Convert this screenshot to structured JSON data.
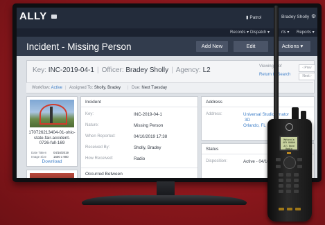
{
  "app": {
    "logo": "ALLY",
    "mail_icon": "mail-icon",
    "mode_label": "Patrol",
    "user_name": "Bradey Sholly",
    "settings_icon": "gear-icon"
  },
  "nav": {
    "items": [
      "Records",
      "Dispatch",
      "rts",
      "Reports"
    ]
  },
  "title_bar": {
    "title": "Incident - Missing Person",
    "buttons": {
      "add_new": "Add New",
      "edit": "Edit",
      "actions": "Actions"
    }
  },
  "summary": {
    "key_label": "Key:",
    "key_value": "INC-2019-04-1",
    "officer_label": "Officer:",
    "officer_value": "Bradey Sholly",
    "agency_label": "Agency:",
    "agency_value": "L2",
    "viewing": "Viewing 1 of",
    "return_to_search": "Return to Search",
    "prev": "Prev",
    "next": "Next"
  },
  "workflow": {
    "workflow_label": "Workflow:",
    "workflow_value": "Active",
    "assigned_label": "Assigned To:",
    "assigned_value": "Sholly, Bradey",
    "due_label": "Due:",
    "due_value": "Next Tuesday"
  },
  "attachment": {
    "file_name": "170726213404-01-ohio-state-fair-accident-0726-full-169",
    "date_taken_label": "Date Taken",
    "date_taken_value": "04/16/2019",
    "image_size_label": "Image Size",
    "image_size_value": "1600 x 900",
    "download": "Download"
  },
  "incident": {
    "heading": "Incident",
    "rows": [
      {
        "label": "Key:",
        "value": "INC-2019-04-1"
      },
      {
        "label": "Nature:",
        "value": "Missing Person"
      },
      {
        "label": "When Reported:",
        "value": "04/10/2019 17:38"
      },
      {
        "label": "Received By:",
        "value": "Sholly, Bradey"
      },
      {
        "label": "How Received:",
        "value": "Radio"
      }
    ],
    "occurred_heading": "Occurred Between"
  },
  "address": {
    "heading": "Address",
    "label": "Address:",
    "line1": "Universal Studios",
    "line1_extra": "rnator",
    "line2": "3D",
    "line3": "Orlando, FL"
  },
  "status": {
    "heading": "Status",
    "label": "Disposition:",
    "value": "Active - 04/10/2019"
  },
  "radio": {
    "screen_line1": "Motorola",
    "screen_line2": "APX 8000H",
    "screen_line3": "All Band Radio"
  },
  "colors": {
    "background": "#8f1a1f",
    "header": "#232c3b",
    "title_bar": "#323c4d",
    "link": "#3f7fc8"
  }
}
